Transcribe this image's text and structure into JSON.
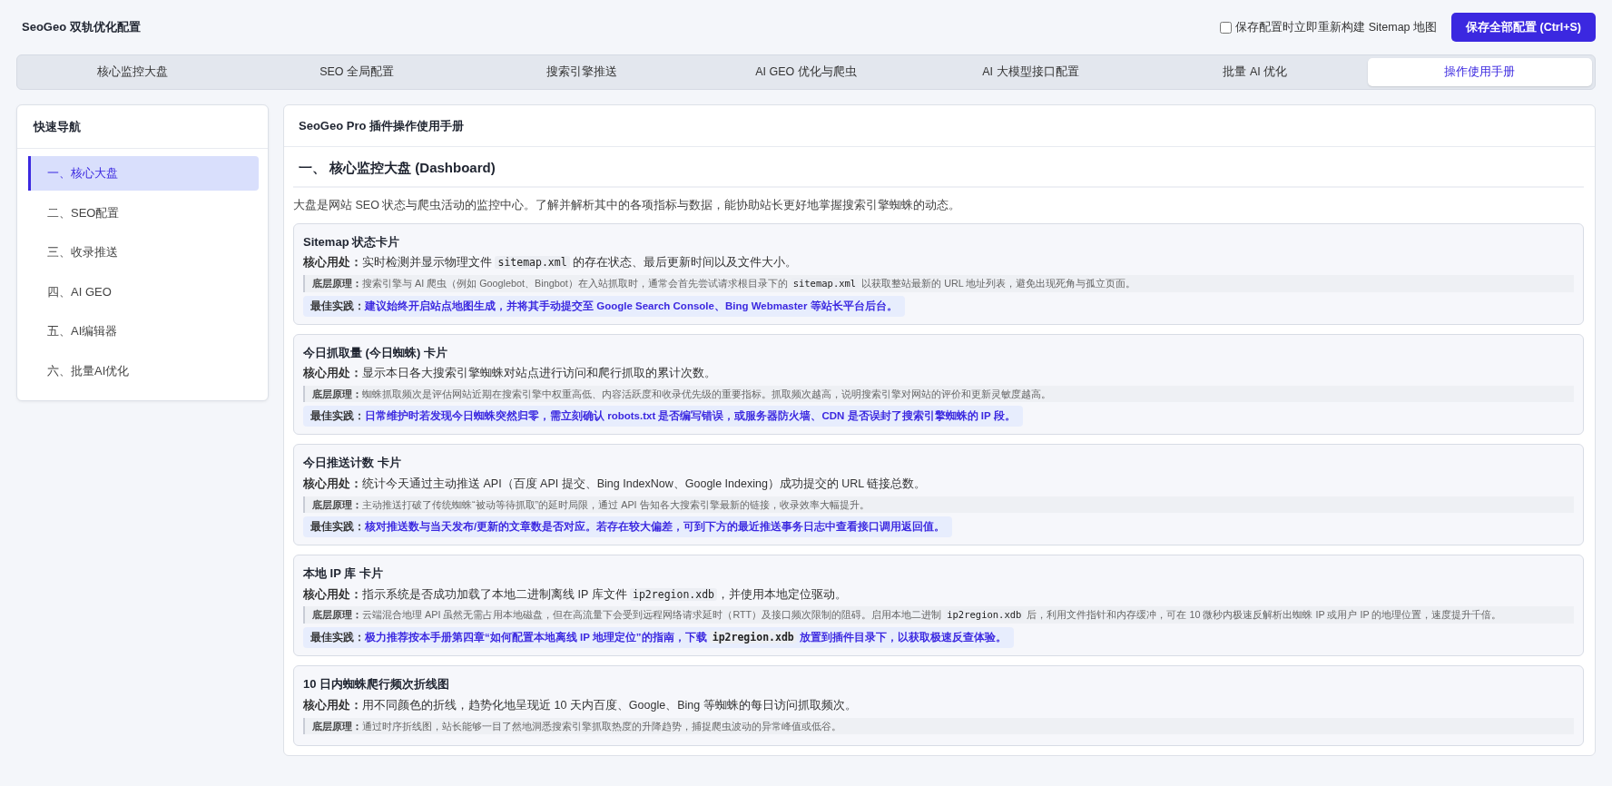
{
  "header": {
    "title": "SeoGeo 双轨优化配置",
    "rebuild_option": {
      "label": "保存配置时立即重新构建 Sitemap 地图",
      "checked": false
    },
    "save_button": "保存全部配置 (Ctrl+S)"
  },
  "tabs": [
    {
      "label": "核心监控大盘",
      "selected": false
    },
    {
      "label": "SEO 全局配置",
      "selected": false
    },
    {
      "label": "搜索引擎推送",
      "selected": false
    },
    {
      "label": "AI GEO 优化与爬虫",
      "selected": false
    },
    {
      "label": "AI 大模型接口配置",
      "selected": false
    },
    {
      "label": "批量 AI 优化",
      "selected": false
    },
    {
      "label": "操作使用手册",
      "selected": true
    }
  ],
  "sidebar": {
    "title": "快速导航",
    "items": [
      {
        "label": "一、核心大盘",
        "selected": true
      },
      {
        "label": "二、SEO配置",
        "selected": false
      },
      {
        "label": "三、收录推送",
        "selected": false
      },
      {
        "label": "四、AI GEO",
        "selected": false
      },
      {
        "label": "五、AI编辑器",
        "selected": false
      },
      {
        "label": "六、批量AI优化",
        "selected": false
      }
    ]
  },
  "manual": {
    "title": "SeoGeo Pro 插件操作使用手册",
    "section_heading": "一、 核心监控大盘 (Dashboard)",
    "intro": "大盘是网站 SEO 状态与爬虫活动的监控中心。了解并解析其中的各项指标与数据，能协助站长更好地掌握搜索引擎蜘蛛的动态。",
    "cards": [
      {
        "title": "Sitemap 状态卡片",
        "usage": {
          "label": "核心用处：",
          "parts": [
            {
              "kind": "text",
              "text": "实时检测并显示物理文件 "
            },
            {
              "kind": "code",
              "text": "sitemap.xml"
            },
            {
              "kind": "text",
              "text": " 的存在状态、最后更新时间以及文件大小。"
            }
          ]
        },
        "principle": {
          "label": "底层原理：",
          "parts": [
            {
              "kind": "text",
              "text": "搜索引擎与 AI 爬虫（例如 Googlebot、Bingbot）在入站抓取时，通常会首先尝试请求根目录下的 "
            },
            {
              "kind": "code",
              "text": "sitemap.xml"
            },
            {
              "kind": "text",
              "text": " 以获取整站最新的 URL 地址列表，避免出现死角与孤立页面。"
            }
          ]
        },
        "best_practice": {
          "label": "最佳实践：",
          "parts": [
            {
              "kind": "text",
              "text": "建议始终开启站点地图生成，并将其手动提交至 Google Search Console、Bing Webmaster 等站长平台后台。"
            }
          ]
        }
      },
      {
        "title": "今日抓取量 (今日蜘蛛) 卡片",
        "usage": {
          "label": "核心用处：",
          "parts": [
            {
              "kind": "text",
              "text": "显示本日各大搜索引擎蜘蛛对站点进行访问和爬行抓取的累计次数。"
            }
          ]
        },
        "principle": {
          "label": "底层原理：",
          "parts": [
            {
              "kind": "text",
              "text": "蜘蛛抓取频次是评估网站近期在搜索引擎中权重高低、内容活跃度和收录优先级的重要指标。抓取频次越高，说明搜索引擎对网站的评价和更新灵敏度越高。"
            }
          ]
        },
        "best_practice": {
          "label": "最佳实践：",
          "parts": [
            {
              "kind": "text",
              "text": "日常维护时若发现今日蜘蛛突然归零，需立刻确认 robots.txt 是否编写错误，或服务器防火墙、CDN 是否误封了搜索引擎蜘蛛的 IP 段。"
            }
          ]
        }
      },
      {
        "title": "今日推送计数 卡片",
        "usage": {
          "label": "核心用处：",
          "parts": [
            {
              "kind": "text",
              "text": "统计今天通过主动推送 API（百度 API 提交、Bing IndexNow、Google Indexing）成功提交的 URL 链接总数。"
            }
          ]
        },
        "principle": {
          "label": "底层原理：",
          "parts": [
            {
              "kind": "text",
              "text": "主动推送打破了传统蜘蛛“被动等待抓取”的延时局限，通过 API 告知各大搜索引擎最新的链接，收录效率大幅提升。"
            }
          ]
        },
        "best_practice": {
          "label": "最佳实践：",
          "parts": [
            {
              "kind": "text",
              "text": "核对推送数与当天发布/更新的文章数是否对应。若存在较大偏差，可到下方的最近推送事务日志中查看接口调用返回值。"
            }
          ]
        }
      },
      {
        "title": "本地 IP 库 卡片",
        "usage": {
          "label": "核心用处：",
          "parts": [
            {
              "kind": "text",
              "text": "指示系统是否成功加载了本地二进制离线 IP 库文件 "
            },
            {
              "kind": "code",
              "text": "ip2region.xdb"
            },
            {
              "kind": "text",
              "text": "，并使用本地定位驱动。"
            }
          ]
        },
        "principle": {
          "label": "底层原理：",
          "parts": [
            {
              "kind": "text",
              "text": "云端混合地理 API 虽然无需占用本地磁盘，但在高流量下会受到远程网络请求延时（RTT）及接口频次限制的阻碍。启用本地二进制 "
            },
            {
              "kind": "code",
              "text": "ip2region.xdb"
            },
            {
              "kind": "text",
              "text": " 后，利用文件指针和内存缓冲，可在 10 微秒内极速反解析出蜘蛛 IP 或用户 IP 的地理位置，速度提升千倍。"
            }
          ]
        },
        "best_practice": {
          "label": "最佳实践：",
          "parts": [
            {
              "kind": "text",
              "text": "极力推荐按本手册第四章“如何配置本地离线 IP 地理定位”的指南，下载 "
            },
            {
              "kind": "code",
              "text": "ip2region.xdb"
            },
            {
              "kind": "text",
              "text": " 放置到插件目录下，以获取极速反查体验。"
            }
          ]
        }
      },
      {
        "title": "10 日内蜘蛛爬行频次折线图",
        "usage": {
          "label": "核心用处：",
          "parts": [
            {
              "kind": "text",
              "text": "用不同颜色的折线，趋势化地呈现近 10 天内百度、Google、Bing 等蜘蛛的每日访问抓取频次。"
            }
          ]
        },
        "principle": {
          "label": "底层原理：",
          "parts": [
            {
              "kind": "text",
              "text": "通过时序折线图，站长能够一目了然地洞悉搜索引擎抓取热度的升降趋势，捕捉爬虫波动的异常峰值或低谷。"
            }
          ]
        }
      }
    ]
  }
}
